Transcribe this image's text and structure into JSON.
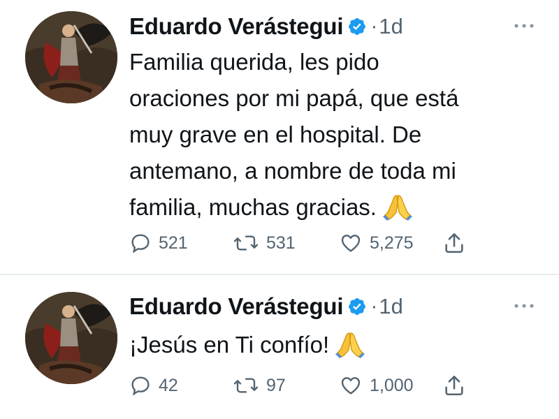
{
  "tweets": [
    {
      "author_name": "Eduardo Verástegui",
      "dot": "·",
      "time": "1d",
      "text": "Familia querida, les pido\noraciones por mi papá, que está\nmuy grave en el hospital. De\nantemano, a nombre de toda mi\nfamilia, muchas gracias.",
      "emoji": "folded-hands-emoji",
      "replies": "521",
      "retweets": "531",
      "likes": "5,275"
    },
    {
      "author_name": "Eduardo Verástegui",
      "dot": "·",
      "time": "1d",
      "text": "¡Jesús en Ti confío!",
      "emoji": "folded-hands-emoji",
      "replies": "42",
      "retweets": "97",
      "likes": "1,000"
    }
  ],
  "icons": {
    "verified": "verified-badge-icon",
    "more": "more-options-icon",
    "reply": "reply-icon",
    "retweet": "retweet-icon",
    "like": "heart-icon",
    "share": "share-icon"
  },
  "colors": {
    "verified_blue": "#1d9bf0",
    "text_primary": "#0f1419",
    "text_secondary": "#536471",
    "divider": "#e6ecf0"
  }
}
